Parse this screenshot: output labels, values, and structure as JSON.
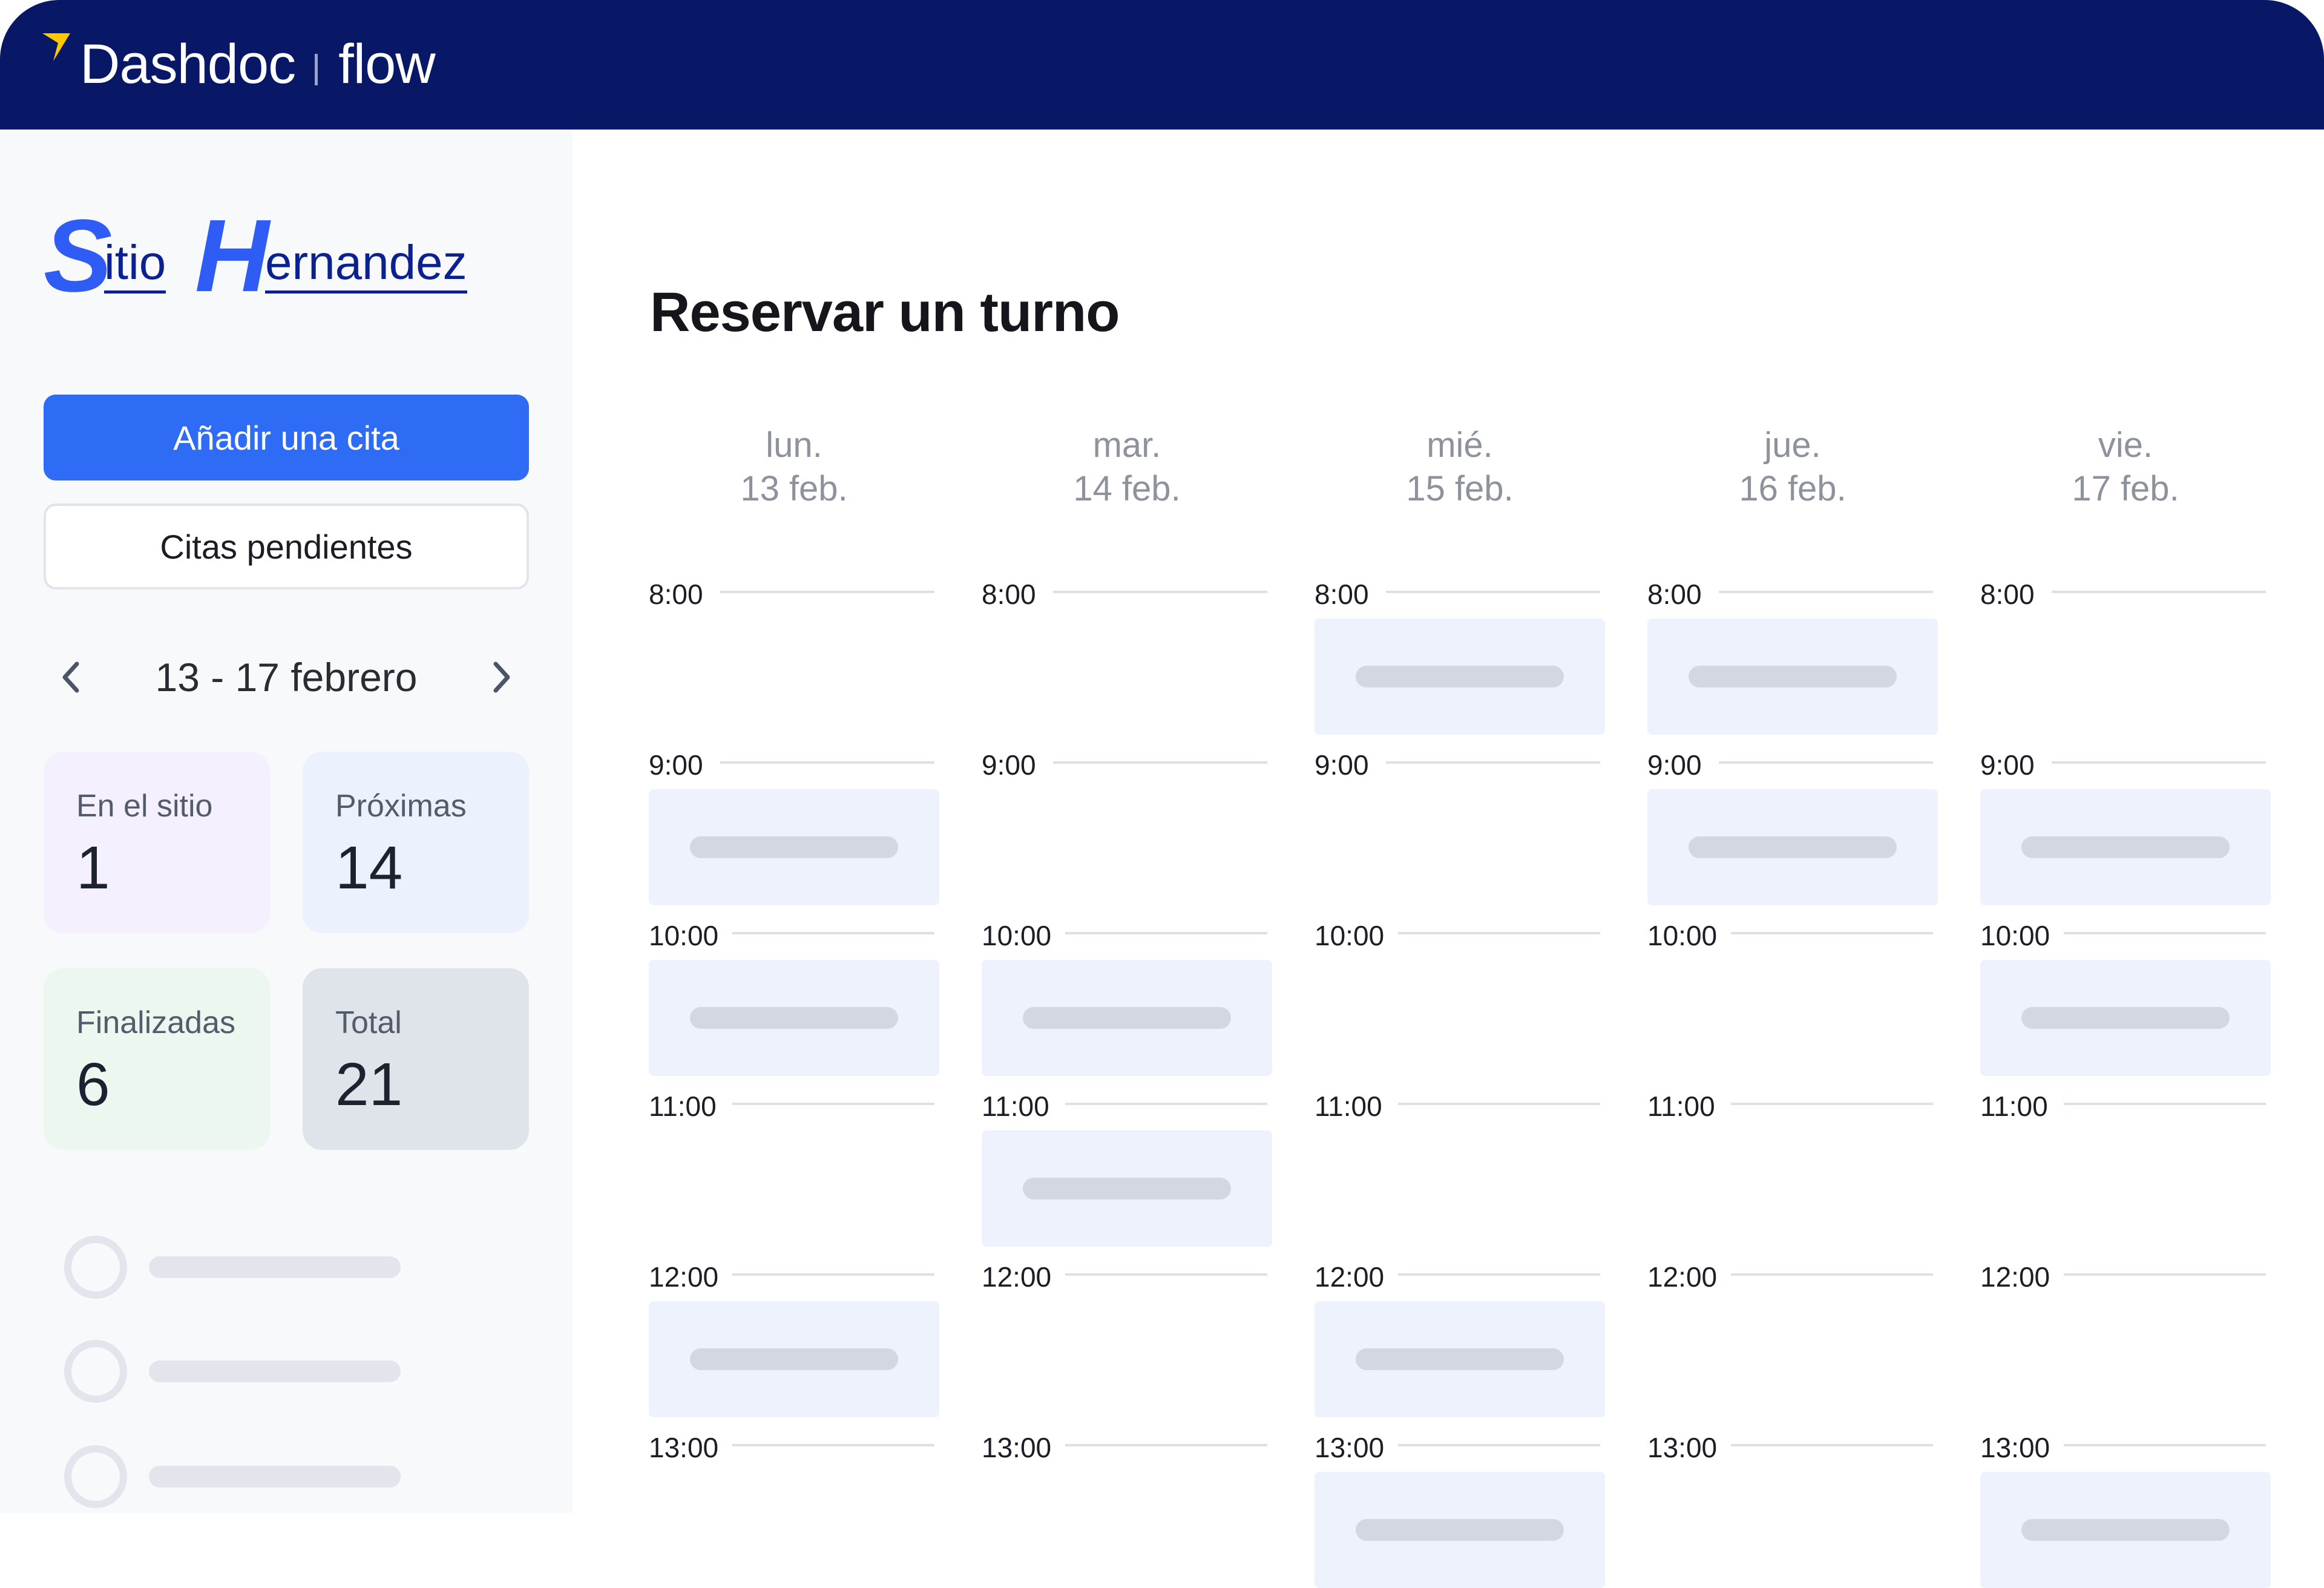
{
  "header": {
    "brand": "Dashdoc",
    "product": "flow"
  },
  "sidebar": {
    "site_logo": {
      "first_initial": "S",
      "first_rest": "itio",
      "second_initial": "H",
      "second_rest": "ernandez"
    },
    "add_appointment_label": "Añadir una cita",
    "pending_appointments_label": "Citas pendientes",
    "week_range": "13 - 17 febrero",
    "stats": [
      {
        "label": "En el sitio",
        "value": "1"
      },
      {
        "label": "Próximas",
        "value": "14"
      },
      {
        "label": "Finalizadas",
        "value": "6"
      },
      {
        "label": "Total",
        "value": "21"
      }
    ]
  },
  "main": {
    "title": "Reservar un turno",
    "days": [
      {
        "weekday": "lun.",
        "date": "13 feb."
      },
      {
        "weekday": "mar.",
        "date": "14 feb."
      },
      {
        "weekday": "mié.",
        "date": "15 feb."
      },
      {
        "weekday": "jue.",
        "date": "16 feb."
      },
      {
        "weekday": "vie.",
        "date": "17 feb."
      }
    ],
    "hours": [
      "8:00",
      "9:00",
      "10:00",
      "11:00",
      "12:00",
      "13:00"
    ]
  },
  "colors": {
    "header_bg": "#081866",
    "brand_accent": "#FFC800",
    "primary": "#2F6CF6",
    "slot_bg": "#EEF2FD"
  }
}
